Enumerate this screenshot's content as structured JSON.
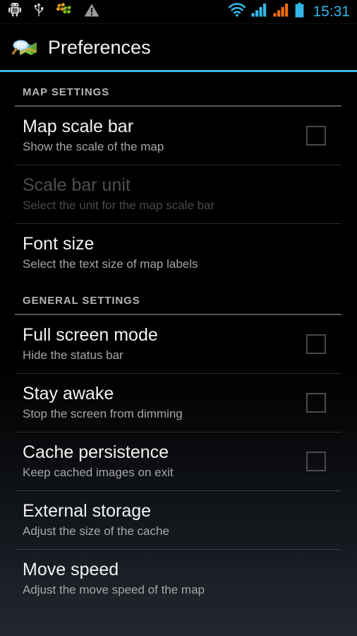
{
  "status_bar": {
    "icons": [
      {
        "name": "android-debug-icon",
        "label": "adb"
      },
      {
        "name": "usb-icon",
        "label": "USB"
      },
      {
        "name": "flower-sync-icon",
        "label": "sync"
      },
      {
        "name": "warning-triangle-icon",
        "label": "warning"
      }
    ],
    "right_icons": [
      {
        "name": "wifi-icon",
        "label": "Wi-Fi"
      },
      {
        "name": "signal-bars-icon-1",
        "label": "Signal 1"
      },
      {
        "name": "signal-bars-icon-2",
        "label": "Signal 2"
      },
      {
        "name": "battery-icon",
        "label": "Battery"
      }
    ],
    "clock": "15:31",
    "accent_color": "#33b5e5"
  },
  "action_bar": {
    "icon_name": "map-magnifier-icon",
    "title": "Preferences",
    "accent_color": "#33b5e5"
  },
  "sections": [
    {
      "header": "MAP SETTINGS",
      "items": [
        {
          "title": "Map scale bar",
          "summary": "Show the scale of the map",
          "widget": "checkbox",
          "checked": false,
          "enabled": true,
          "name": "pref-map-scale-bar"
        },
        {
          "title": "Scale bar unit",
          "summary": "Select the unit for the map scale bar",
          "widget": "none",
          "checked": false,
          "enabled": false,
          "name": "pref-scale-bar-unit"
        },
        {
          "title": "Font size",
          "summary": "Select the text size of map labels",
          "widget": "none",
          "checked": false,
          "enabled": true,
          "name": "pref-font-size"
        }
      ]
    },
    {
      "header": "GENERAL SETTINGS",
      "items": [
        {
          "title": "Full screen mode",
          "summary": "Hide the status bar",
          "widget": "checkbox",
          "checked": false,
          "enabled": true,
          "name": "pref-full-screen-mode"
        },
        {
          "title": "Stay awake",
          "summary": "Stop the screen from dimming",
          "widget": "checkbox",
          "checked": false,
          "enabled": true,
          "name": "pref-stay-awake"
        },
        {
          "title": "Cache persistence",
          "summary": "Keep cached images on exit",
          "widget": "checkbox",
          "checked": false,
          "enabled": true,
          "name": "pref-cache-persistence"
        },
        {
          "title": "External storage",
          "summary": "Adjust the size of the cache",
          "widget": "none",
          "checked": false,
          "enabled": true,
          "name": "pref-external-storage"
        },
        {
          "title": "Move speed",
          "summary": "Adjust the move speed of the map",
          "widget": "none",
          "checked": false,
          "enabled": true,
          "name": "pref-move-speed"
        }
      ]
    }
  ]
}
